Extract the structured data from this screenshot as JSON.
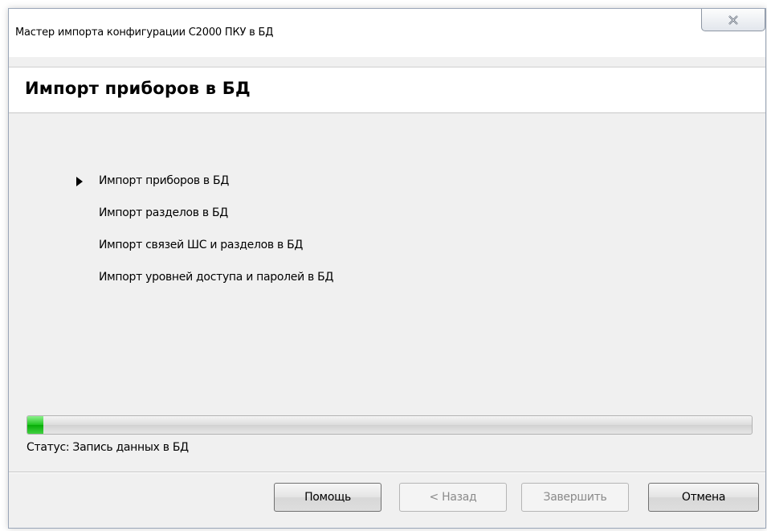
{
  "window": {
    "title": "Мастер импорта конфигурации С2000 ПКУ в БД",
    "close_icon": "close-x-icon"
  },
  "header": {
    "title": "Импорт приборов в БД"
  },
  "steps": [
    {
      "label": "Импорт приборов в БД",
      "current": true
    },
    {
      "label": "Импорт разделов в БД",
      "current": false
    },
    {
      "label": "Импорт связей ШС и разделов в БД",
      "current": false
    },
    {
      "label": "Импорт уровней доступа и паролей в БД",
      "current": false
    }
  ],
  "progress": {
    "fraction": 0.022,
    "color": "#1fc51f"
  },
  "status": {
    "text": "Статус: Запись данных в БД"
  },
  "buttons": {
    "help": "Помощь",
    "back": "< Назад",
    "finish": "Завершить",
    "cancel": "Отмена"
  },
  "colors": {
    "window_bg": "#f0f0f0",
    "header_bg": "#ffffff",
    "progress_fill": "#1fc51f"
  }
}
